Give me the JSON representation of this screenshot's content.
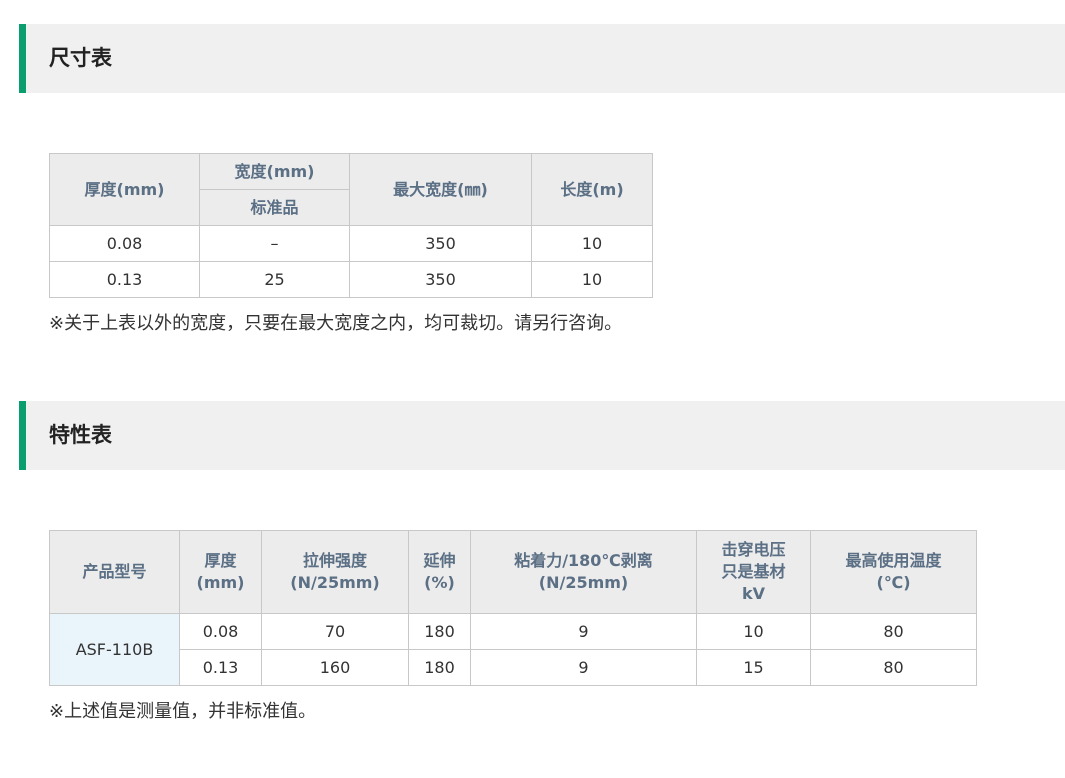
{
  "size_section": {
    "title": "尺寸表",
    "headers": {
      "thickness": "厚度(mm)",
      "width": "宽度(mm)",
      "width_sub": "标准品",
      "max_width": "最大宽度(㎜)",
      "length": "长度(m)"
    },
    "rows": [
      [
        "0.08",
        "–",
        "350",
        "10"
      ],
      [
        "0.13",
        "25",
        "350",
        "10"
      ]
    ],
    "note": "※关于上表以外的宽度，只要在最大宽度之内，均可裁切。请另行咨询。"
  },
  "props_section": {
    "title": "特性表",
    "headers": {
      "model": "产品型号",
      "thickness_l1": "厚度",
      "thickness_l2": "(mm)",
      "tensile_l1": "拉伸强度",
      "tensile_l2": "(N/25mm)",
      "elong_l1": "延伸",
      "elong_l2": "(%)",
      "peel_l1": "粘着力/180℃剥离",
      "peel_l2": "(N/25mm)",
      "breakdown_l1": "击穿电压",
      "breakdown_l2": "只是基材",
      "breakdown_l3": "kV",
      "maxtemp_l1": "最高使用温度",
      "maxtemp_l2": "(℃)"
    },
    "model": "ASF-110B",
    "rows": [
      [
        "0.08",
        "70",
        "180",
        "9",
        "10",
        "80"
      ],
      [
        "0.13",
        "160",
        "180",
        "9",
        "15",
        "80"
      ]
    ],
    "note": "※上述值是测量值，并非标准值。"
  },
  "colors": {
    "accent": "#0a9e6e",
    "header_text": "#5b6f85",
    "header_bg": "#ececec",
    "model_cell_bg": "#eaf4fb"
  }
}
